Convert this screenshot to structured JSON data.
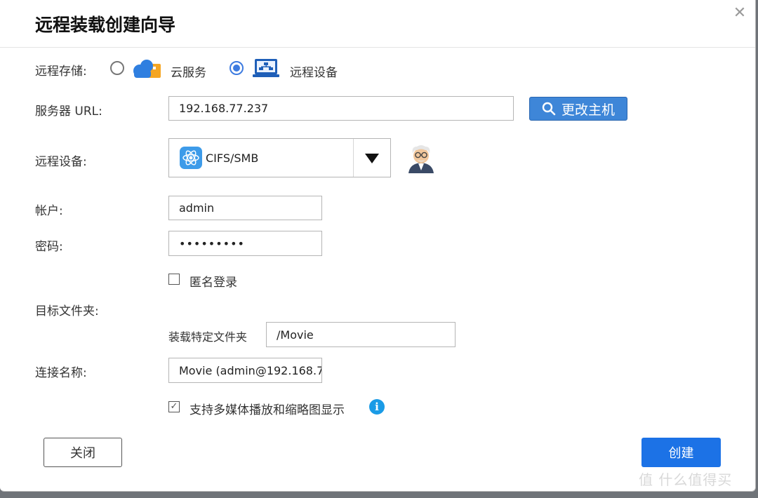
{
  "dialog": {
    "title": "远程装载创建向导",
    "close_glyph": "✕"
  },
  "storage": {
    "label": "远程存储:",
    "options": [
      {
        "label": "云服务",
        "selected": false
      },
      {
        "label": "远程设备",
        "selected": true
      }
    ]
  },
  "server": {
    "label": "服务器 URL:",
    "value": "192.168.77.237",
    "change_host_button": "更改主机"
  },
  "device": {
    "label": "远程设备:",
    "selected": "CIFS/SMB"
  },
  "account": {
    "label": "帐户:",
    "value": "admin"
  },
  "password": {
    "label": "密码:",
    "value": "•••••••••"
  },
  "anonymous": {
    "label": "匿名登录",
    "checked": false
  },
  "target": {
    "label": "目标文件夹:",
    "sub_label": "装载特定文件夹",
    "value": "/Movie"
  },
  "connection": {
    "label": "连接名称:",
    "value": "Movie (admin@192.168.7"
  },
  "multimedia": {
    "label": "支持多媒体播放和缩略图显示",
    "checked": true,
    "check_glyph": "✓",
    "info_glyph": "i"
  },
  "footer": {
    "close_button": "关闭",
    "create_button": "创建"
  },
  "watermark": "值 什么值得买",
  "colors": {
    "primary": "#1c72e6",
    "change_host": "#3e86d8",
    "info": "#1a9be6"
  }
}
